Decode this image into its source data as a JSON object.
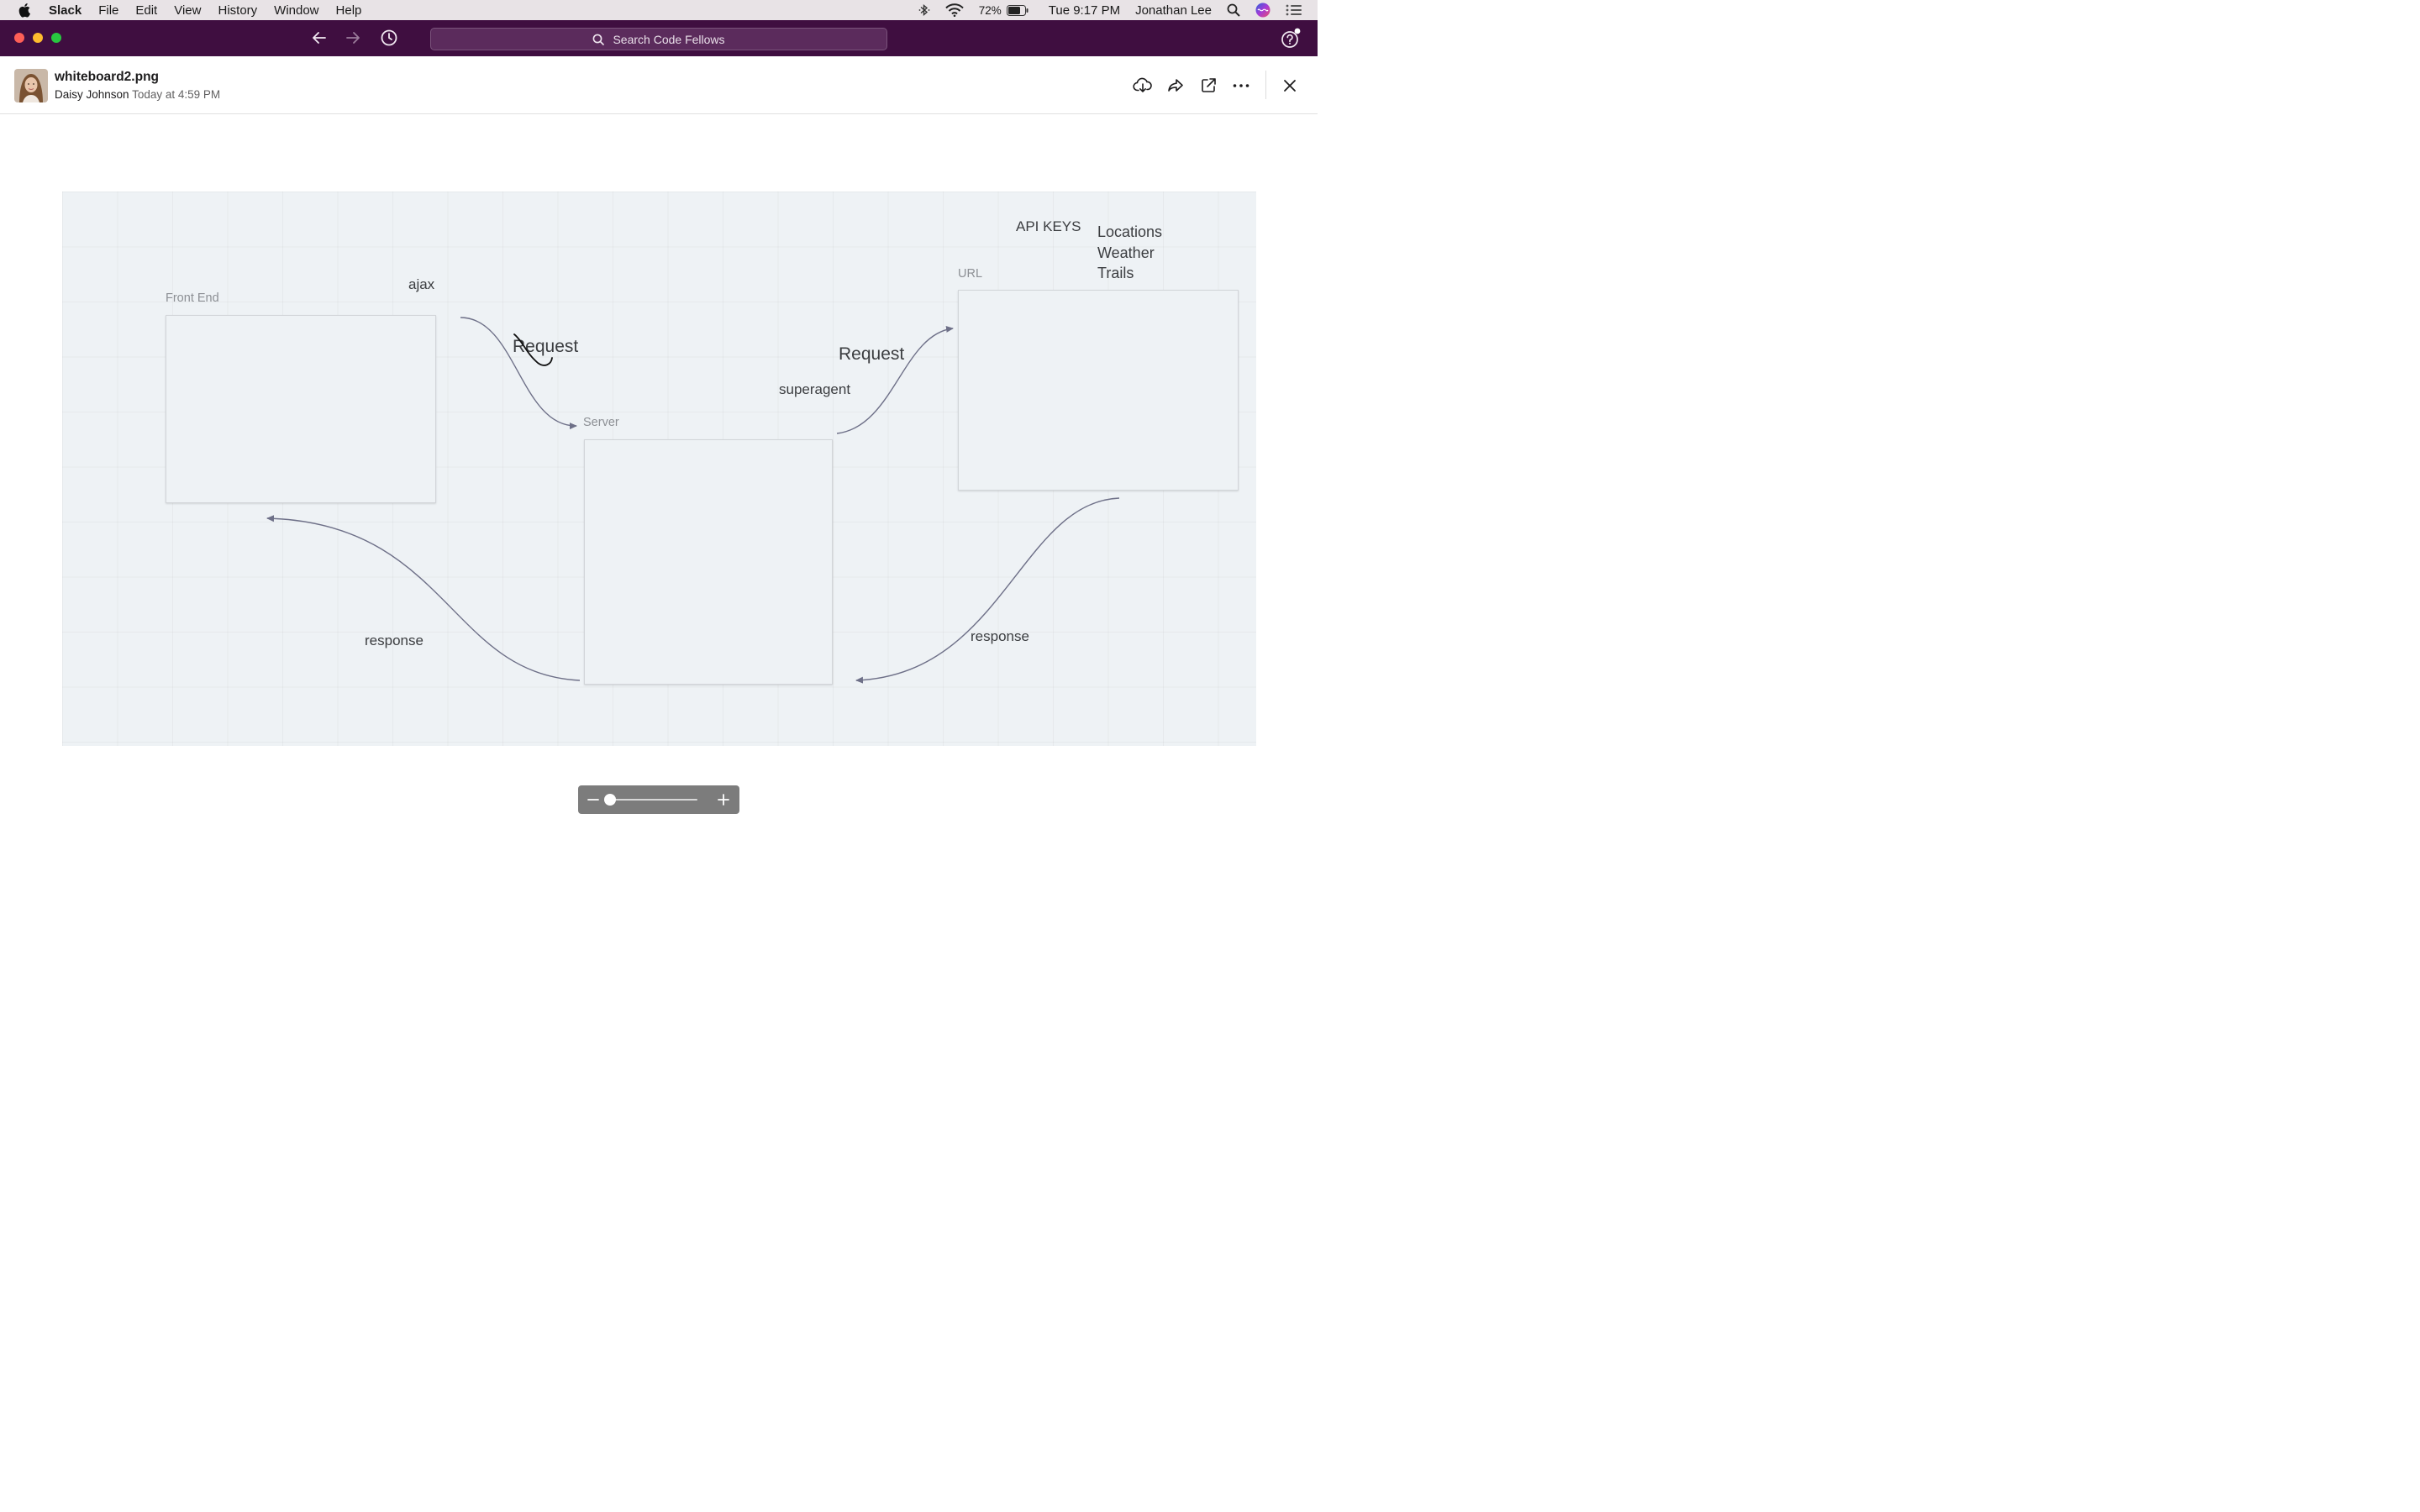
{
  "menubar": {
    "app_name": "Slack",
    "menus": [
      "File",
      "Edit",
      "View",
      "History",
      "Window",
      "Help"
    ],
    "battery": "72%",
    "clock": "Tue 9:17 PM",
    "user": "Jonathan Lee"
  },
  "titlebar": {
    "search_placeholder": "Search Code Fellows"
  },
  "file": {
    "name": "whiteboard2.png",
    "author": "Daisy Johnson",
    "timestamp": "Today at 4:59 PM"
  },
  "whiteboard": {
    "front_end_caption": "Front End",
    "server_caption": "Server",
    "url_caption": "URL",
    "ajax": "ajax",
    "request_left": "Request",
    "request_right": "Request",
    "superagent": "superagent",
    "api_keys": "API KEYS",
    "api_list": [
      "Locations",
      "Weather",
      "Trails"
    ],
    "response_left": "response",
    "response_right": "response"
  },
  "zoom": {
    "level": 0
  },
  "colors": {
    "titlebar_bg": "#3f0e40",
    "whiteboard_bg": "#eef2f5",
    "arrow_stroke": "#6e7088"
  },
  "icons": {
    "header_actions": [
      "download-cloud-icon",
      "share-icon",
      "open-external-icon",
      "more-icon",
      "close-icon"
    ]
  }
}
